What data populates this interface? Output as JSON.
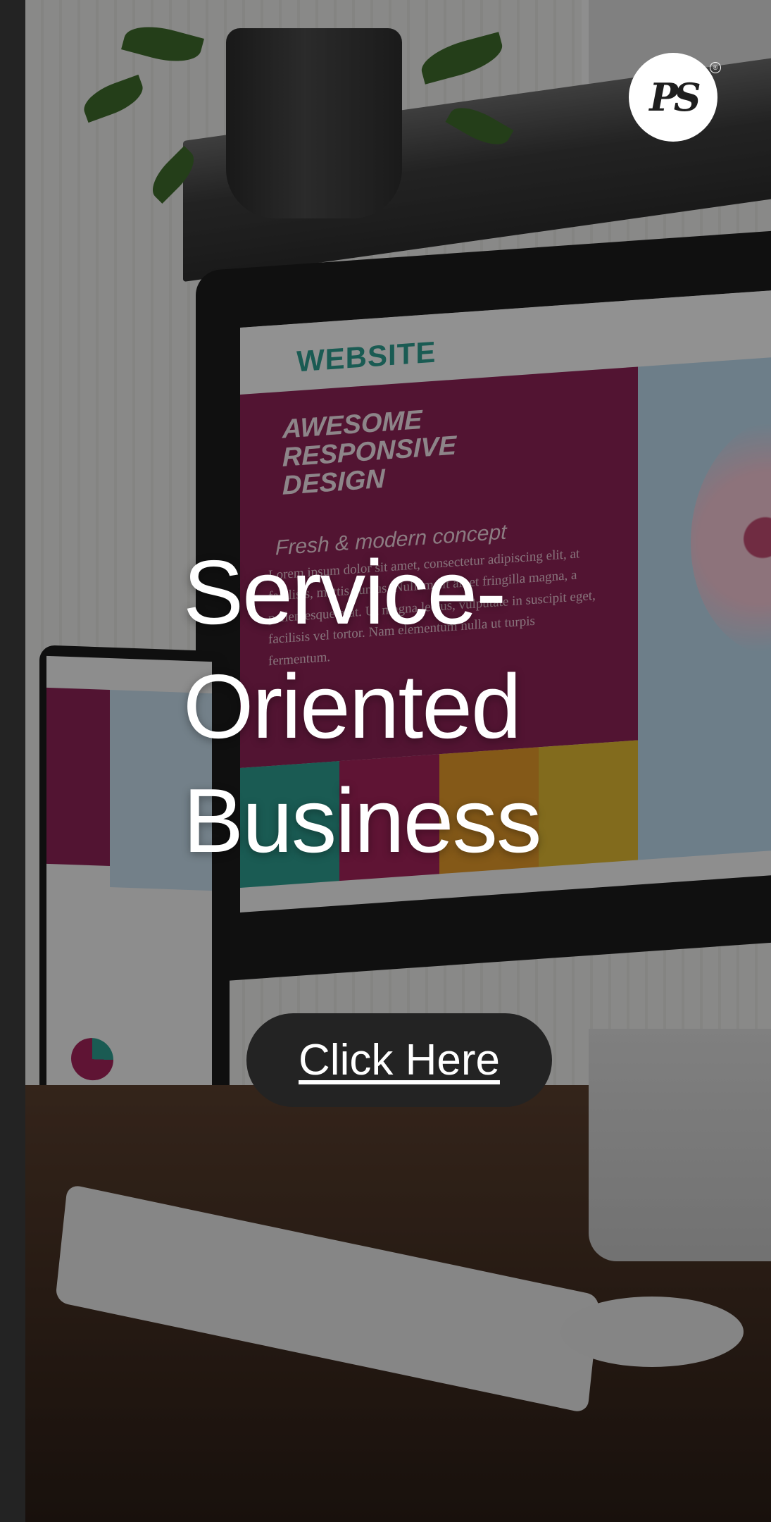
{
  "logo": {
    "text": "PS",
    "registered_mark": "®"
  },
  "headline": {
    "text": "Service-Oriented Business"
  },
  "cta": {
    "label": "Click Here"
  },
  "background": {
    "screen": {
      "logo_text": "WEBSITE",
      "hero_title": "AWESOME RESPONSIVE DESIGN",
      "hero_subtitle": "Fresh & modern concept",
      "hero_body": "Lorem ipsum dolor sit amet, consectetur adipiscing elit, at facilisis, mattis cursus. Nullam sit amet fringilla magna, a pellentesque erat. Ut magna lectus, vulputate in suscipit eget, facilisis vel tortor. Nam elementum nulla ut turpis fermentum."
    },
    "tile_colors": [
      "#2e9e8f",
      "#a4245b",
      "#e39a2a",
      "#e0b932"
    ]
  },
  "colors": {
    "cta_background": "#232323",
    "text": "#ffffff",
    "accent_magenta": "#8e2356",
    "accent_teal": "#2e9e8f"
  }
}
